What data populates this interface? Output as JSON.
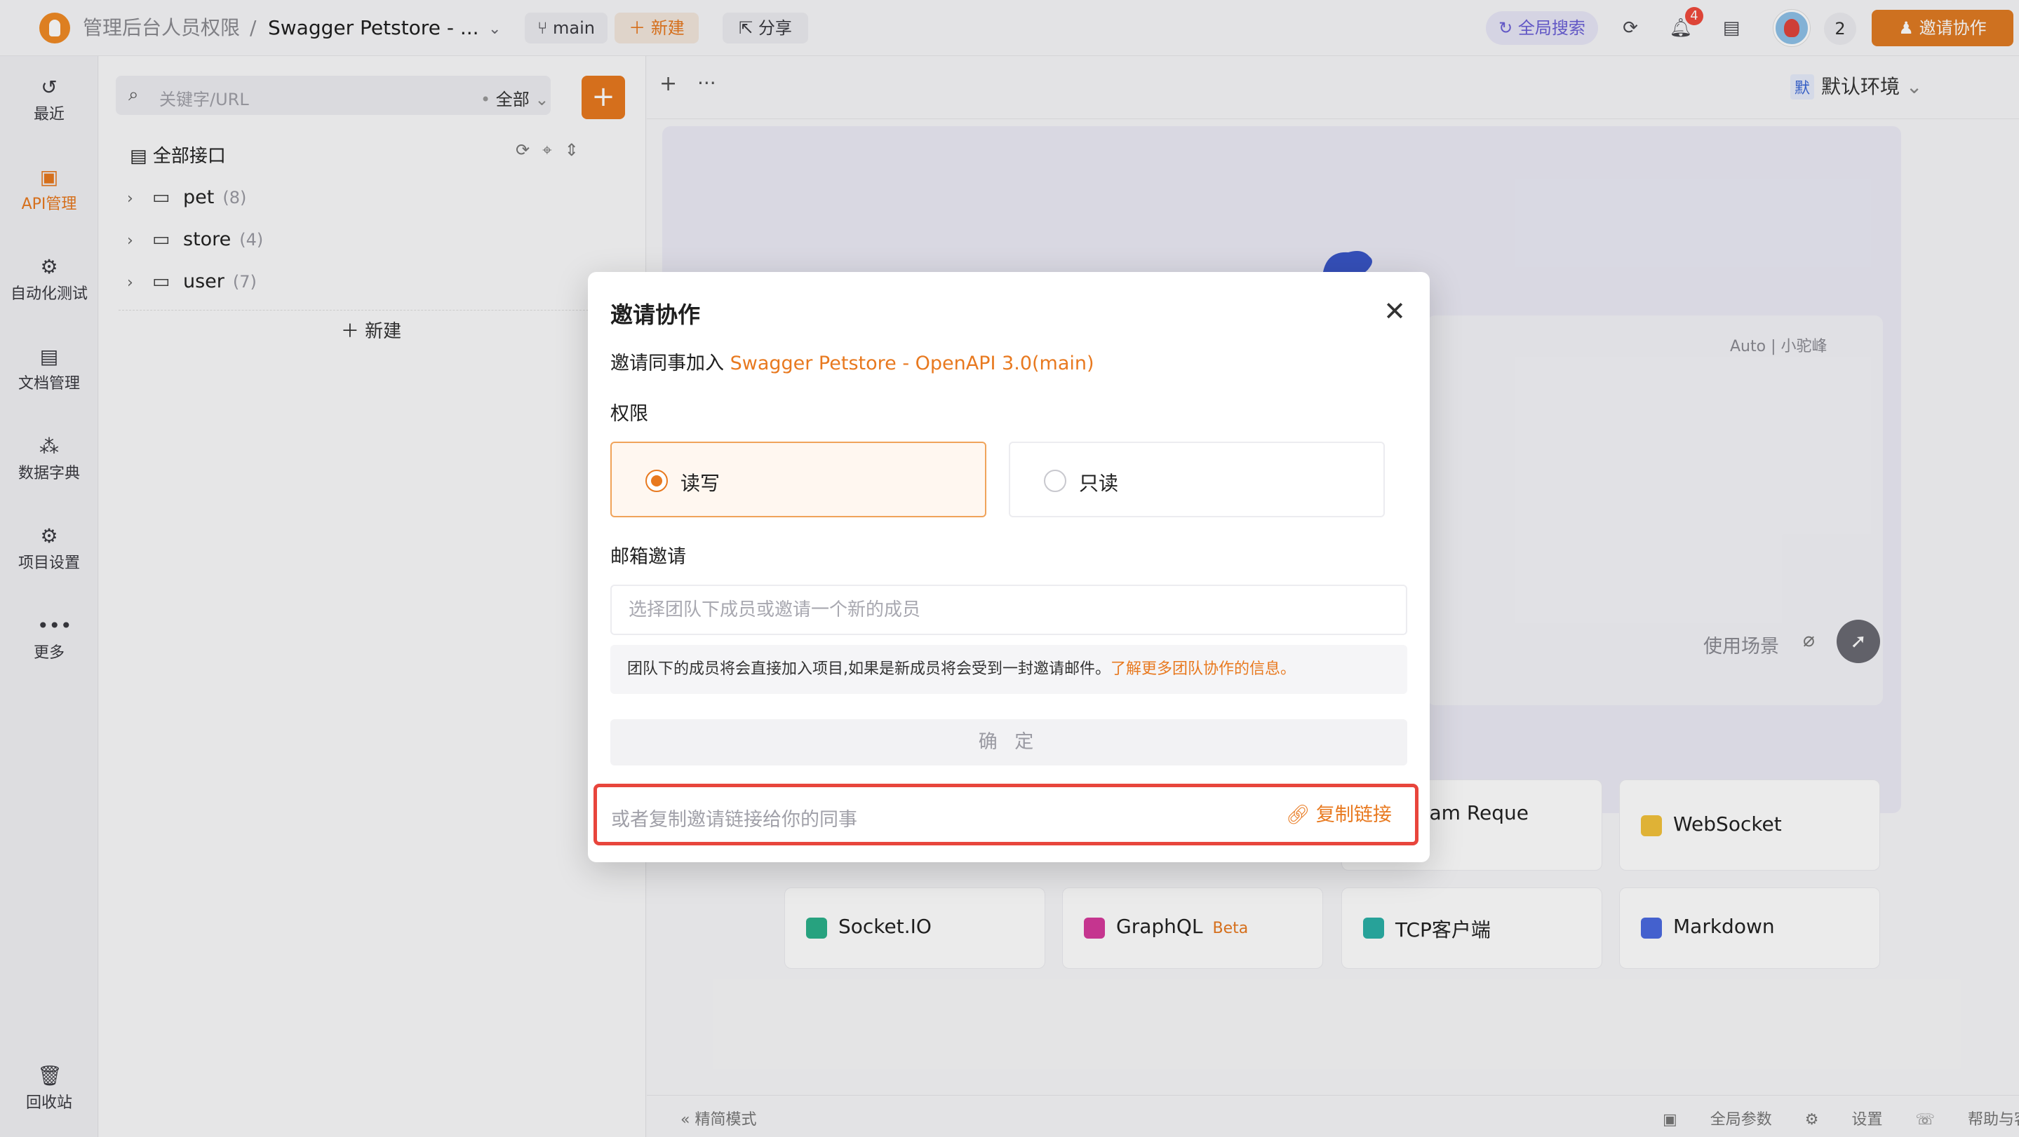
{
  "topbar": {
    "team": "管理后台人员权限",
    "separator": "/",
    "project": "Swagger Petstore - ...",
    "branch": "main",
    "new_label": "新建",
    "share_label": "分享",
    "global_search": "全局搜索",
    "notification_count": "4",
    "member_count": "2",
    "invite_label": "邀请协作"
  },
  "rail": {
    "items": [
      {
        "label": "最近",
        "icon": "history-icon"
      },
      {
        "label": "API管理",
        "icon": "api-icon",
        "active": true
      },
      {
        "label": "自动化测试",
        "icon": "automation-icon"
      },
      {
        "label": "文档管理",
        "icon": "document-icon"
      },
      {
        "label": "数据字典",
        "icon": "data-dictionary-icon"
      },
      {
        "label": "项目设置",
        "icon": "project-settings-icon"
      },
      {
        "label": "更多",
        "icon": "more-icon"
      }
    ],
    "trash": "回收站"
  },
  "tree": {
    "search_placeholder": "关键字/URL",
    "filter": "全部",
    "all_api": "全部接口",
    "folders": [
      {
        "name": "pet",
        "count": "(8)"
      },
      {
        "name": "store",
        "count": "(4)"
      },
      {
        "name": "user",
        "count": "(7)"
      }
    ],
    "new_label": "新建"
  },
  "main": {
    "env_badge": "默",
    "env_name": "默认环境",
    "hero_meta": "Auto | 小驼峰",
    "scenario": "使用场景",
    "cards": [
      {
        "label": "nt Stream Reque",
        "icon": "sse-icon",
        "color": "#e9e9ee"
      },
      {
        "label": "WebSocket",
        "icon": "websocket-icon",
        "color": "#f2c23b"
      },
      {
        "label": "Socket.IO",
        "icon": "socketio-icon",
        "color": "#2bb08a"
      },
      {
        "label": "GraphQL",
        "icon": "graphql-icon",
        "color": "#d63a9c",
        "badge": "Beta"
      },
      {
        "label": "TCP客户端",
        "icon": "tcp-icon",
        "color": "#2bb0a6"
      },
      {
        "label": "Markdown",
        "icon": "markdown-icon",
        "color": "#4a6ae0"
      }
    ],
    "footer_left": "精简模式",
    "footer_right": [
      "全局参数",
      "设置",
      "帮助与客服"
    ]
  },
  "modal": {
    "title": "邀请协作",
    "subtitle_prefix": "邀请同事加入 ",
    "subtitle_project": "Swagger Petstore - OpenAPI 3.0(main)",
    "permission_label": "权限",
    "options": [
      {
        "label": "读写",
        "selected": true
      },
      {
        "label": "只读",
        "selected": false
      }
    ],
    "email_label": "邮箱邀请",
    "email_placeholder": "选择团队下成员或邀请一个新的成员",
    "note_text": "团队下的成员将会直接加入项目,如果是新成员将会受到一封邀请邮件。",
    "note_link": "了解更多团队协作的信息。",
    "confirm_label": "确 定",
    "link_placeholder": "或者复制邀请链接给你的同事",
    "copy_label": "复制链接"
  }
}
